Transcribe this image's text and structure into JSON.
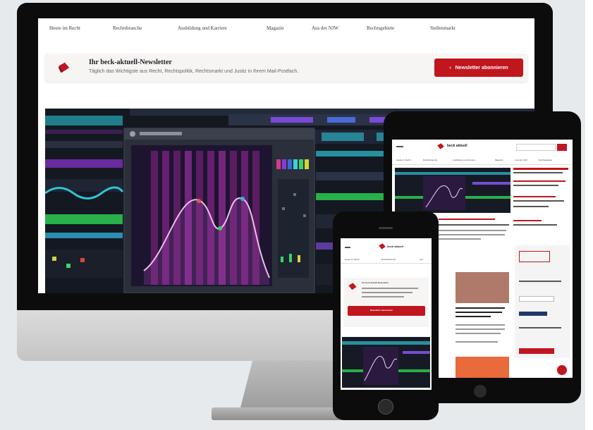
{
  "colors": {
    "accent": "#c0161e",
    "bezel": "#0c0c0c",
    "background": "#e6eaed"
  },
  "desktop": {
    "nav_items": [
      "Heute im Recht",
      "Rechtsbranche",
      "Ausbildung und Karriere",
      "Magazin",
      "Aus der NJW",
      "Rechtsgebiete",
      "Stellenmarkt"
    ],
    "newsletter": {
      "icon": "envelope-icon",
      "title": "Ihr beck-aktuell-Newsletter",
      "subtitle": "Täglich das Wichtigste aus Recht, Rechtspolitik, Rechtsmarkt und Justiz in Ihrem Mail-Postfach.",
      "button_label": "Newsletter abonnieren",
      "button_icon": "chevron-right-icon"
    },
    "hero_image": {
      "icon": "audio-equalizer-image"
    }
  },
  "tablet": {
    "logo": "beck aktuell",
    "nav_items": [
      "Heute im Recht",
      "Rechtsbranche",
      "Ausbildung und Karriere",
      "Magazin",
      "Aus der NJW",
      "Rechtsgebiete"
    ],
    "icons": [
      "menu-icon",
      "search-icon",
      "chat-icon"
    ]
  },
  "phone": {
    "logo": "beck aktuell",
    "nav_items": [
      "Heute im Recht",
      "Rechtsbranche",
      "Aus"
    ],
    "newsletter": {
      "icon": "envelope-icon",
      "title": "Ihr beck-aktuell-Newsletter",
      "button_label": "Newsletter abonnieren"
    }
  }
}
